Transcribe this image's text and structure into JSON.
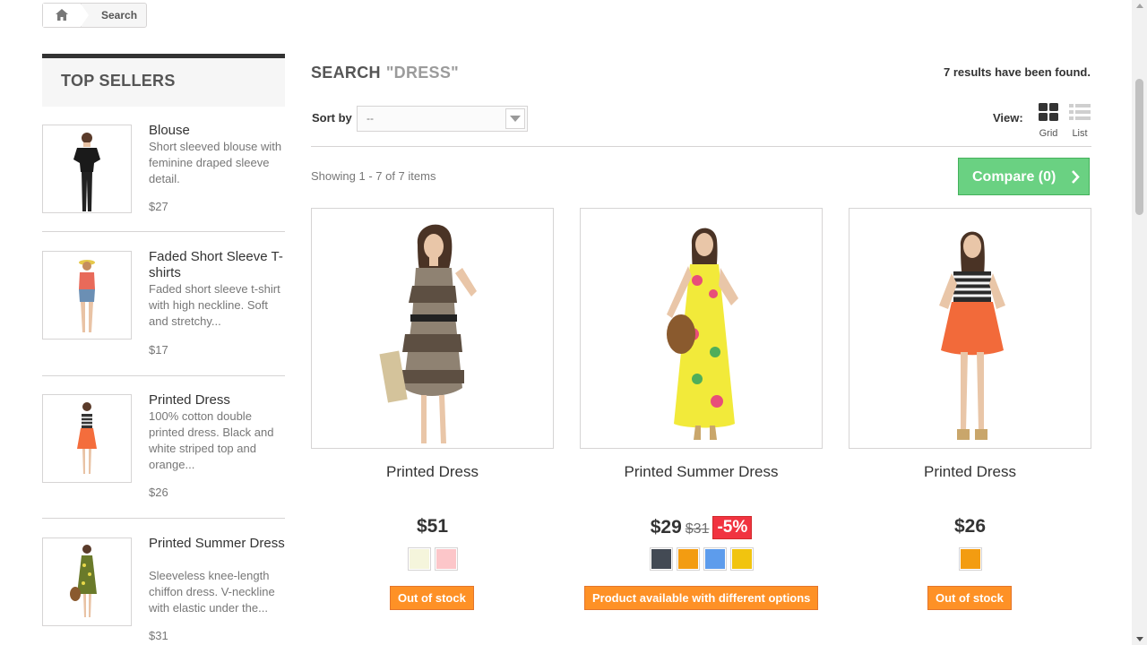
{
  "breadcrumb": {
    "home_icon": "home-icon",
    "current": "Search"
  },
  "sidebar": {
    "title": "TOP SELLERS",
    "items": [
      {
        "name": "Blouse",
        "description": "Short sleeved blouse with feminine draped sleeve detail.",
        "price": "$27"
      },
      {
        "name": "Faded Short Sleeve T-shirts",
        "description": "Faded short sleeve t-shirt with high neckline. Soft and stretchy...",
        "price": "$17"
      },
      {
        "name": "Printed Dress",
        "description": "100% cotton double printed dress. Black and white striped top and orange...",
        "price": "$26"
      },
      {
        "name": "Printed Summer Dress",
        "description": "Sleeveless knee-length chiffon dress. V-neckline with elastic under the...",
        "price": "$31"
      }
    ]
  },
  "search": {
    "heading": "SEARCH",
    "term": "\"DRESS\"",
    "results_text": "7 results have been found.",
    "sort_label": "Sort by",
    "sort_value": "--",
    "view_label": "View:",
    "view_grid": "Grid",
    "view_list": "List",
    "showing": "Showing 1 - 7 of 7 items",
    "compare": "Compare (0)"
  },
  "products": [
    {
      "name": "Printed Dress",
      "price": "$51",
      "old_price": "",
      "discount": "",
      "swatches": [
        "#f5f5dc",
        "#fcc6c9"
      ],
      "stock": "Out of stock"
    },
    {
      "name": "Printed Summer Dress",
      "price": "$29",
      "old_price": "$31",
      "discount": "-5%",
      "swatches": [
        "#434a54",
        "#f39c11",
        "#5d9cec",
        "#f1c40f"
      ],
      "stock": "Product available with different options"
    },
    {
      "name": "Printed Dress",
      "price": "$26",
      "old_price": "",
      "discount": "",
      "swatches": [
        "#f39c11"
      ],
      "stock": "Out of stock"
    }
  ],
  "colors": {
    "compare_green": "#6ad182",
    "stock_orange": "#fe9126",
    "discount_red": "#f13340"
  }
}
